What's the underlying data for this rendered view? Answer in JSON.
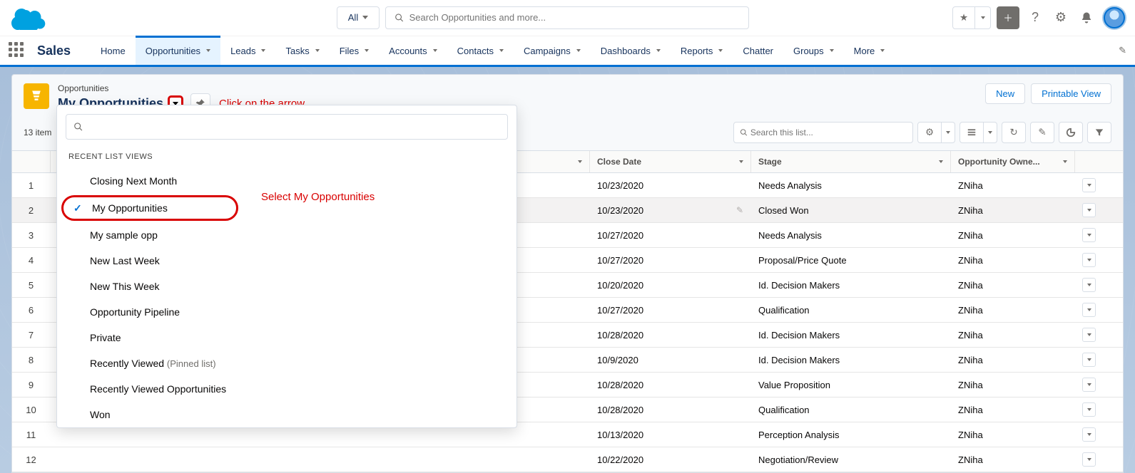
{
  "header": {
    "search_scope": "All",
    "search_placeholder": "Search Opportunities and more..."
  },
  "nav": {
    "app_name": "Sales",
    "items": [
      "Home",
      "Opportunities",
      "Leads",
      "Tasks",
      "Files",
      "Accounts",
      "Contacts",
      "Campaigns",
      "Dashboards",
      "Reports",
      "Chatter",
      "Groups",
      "More"
    ],
    "active": "Opportunities"
  },
  "list_header": {
    "object_label": "Opportunities",
    "list_name": "My Opportunities",
    "annotation_arrow": "Click on the arrow",
    "new_btn": "New",
    "print_btn": "Printable View",
    "item_count": "13 item",
    "list_search_placeholder": "Search this list..."
  },
  "dropdown": {
    "section_label": "RECENT LIST VIEWS",
    "annotation_select": "Select My Opportunities",
    "items": [
      {
        "label": "Closing Next Month"
      },
      {
        "label": "My Opportunities",
        "selected": true
      },
      {
        "label": "My sample opp"
      },
      {
        "label": "New Last Week"
      },
      {
        "label": "New This Week"
      },
      {
        "label": "Opportunity Pipeline"
      },
      {
        "label": "Private"
      },
      {
        "label": "Recently Viewed",
        "pinned": "(Pinned list)"
      },
      {
        "label": "Recently Viewed Opportunities"
      },
      {
        "label": "Won"
      }
    ]
  },
  "table": {
    "columns": {
      "close_date": "Close Date",
      "stage": "Stage",
      "owner": "Opportunity Owne..."
    },
    "rows": [
      {
        "n": 1,
        "close_date": "10/23/2020",
        "stage": "Needs Analysis",
        "owner": "ZNiha"
      },
      {
        "n": 2,
        "close_date": "10/23/2020",
        "stage": "Closed Won",
        "owner": "ZNiha",
        "hover": true
      },
      {
        "n": 3,
        "close_date": "10/27/2020",
        "stage": "Needs Analysis",
        "owner": "ZNiha"
      },
      {
        "n": 4,
        "close_date": "10/27/2020",
        "stage": "Proposal/Price Quote",
        "owner": "ZNiha"
      },
      {
        "n": 5,
        "close_date": "10/20/2020",
        "stage": "Id. Decision Makers",
        "owner": "ZNiha"
      },
      {
        "n": 6,
        "close_date": "10/27/2020",
        "stage": "Qualification",
        "owner": "ZNiha"
      },
      {
        "n": 7,
        "close_date": "10/28/2020",
        "stage": "Id. Decision Makers",
        "owner": "ZNiha"
      },
      {
        "n": 8,
        "close_date": "10/9/2020",
        "stage": "Id. Decision Makers",
        "owner": "ZNiha"
      },
      {
        "n": 9,
        "close_date": "10/28/2020",
        "stage": "Value Proposition",
        "owner": "ZNiha"
      },
      {
        "n": 10,
        "close_date": "10/28/2020",
        "stage": "Qualification",
        "owner": "ZNiha"
      },
      {
        "n": 11,
        "close_date": "10/13/2020",
        "stage": "Perception Analysis",
        "owner": "ZNiha"
      },
      {
        "n": 12,
        "close_date": "10/22/2020",
        "stage": "Negotiation/Review",
        "owner": "ZNiha"
      }
    ]
  }
}
